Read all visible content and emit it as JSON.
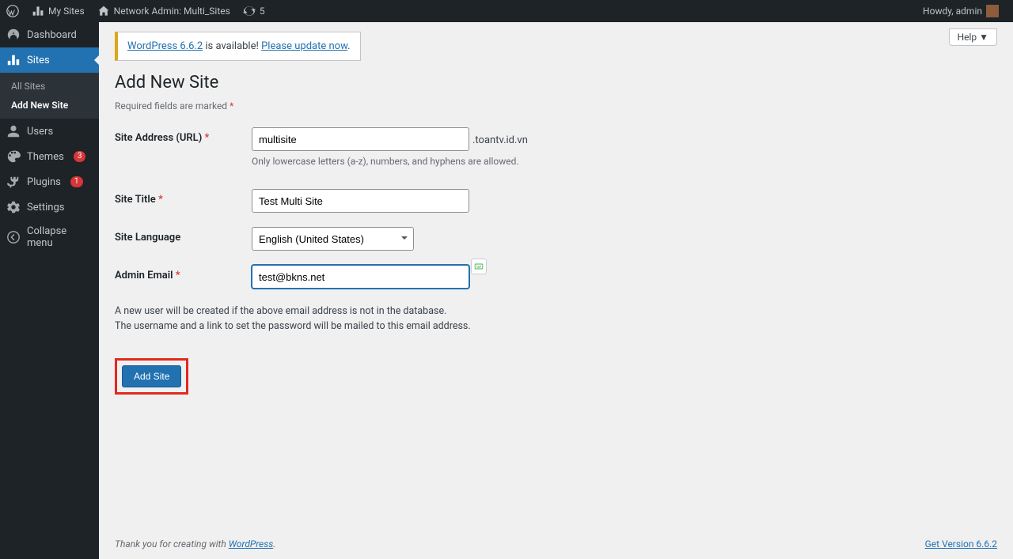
{
  "adminbar": {
    "my_sites": "My Sites",
    "network_admin": "Network Admin: Multi_Sites",
    "updates_count": "5",
    "howdy": "Howdy, admin"
  },
  "sidebar": {
    "dashboard": "Dashboard",
    "sites": "Sites",
    "all_sites": "All Sites",
    "add_new_site": "Add New Site",
    "users": "Users",
    "themes": "Themes",
    "themes_badge": "3",
    "plugins": "Plugins",
    "plugins_badge": "1",
    "settings": "Settings",
    "collapse": "Collapse menu"
  },
  "help_label": "Help ▼",
  "notice": {
    "link1": "WordPress 6.6.2",
    "mid": " is available! ",
    "link2": "Please update now"
  },
  "page": {
    "title": "Add New Site",
    "required_note": "Required fields are marked "
  },
  "form": {
    "site_address_label": "Site Address (URL) ",
    "site_address_value": "multisite",
    "site_address_suffix": ".toantv.id.vn",
    "site_address_hint": "Only lowercase letters (a-z), numbers, and hyphens are allowed.",
    "site_title_label": "Site Title ",
    "site_title_value": "Test Multi Site",
    "site_language_label": "Site Language",
    "site_language_value": "English (United States)",
    "admin_email_label": "Admin Email ",
    "admin_email_value": "test@bkns.net",
    "info_line1": "A new user will be created if the above email address is not in the database.",
    "info_line2": "The username and a link to set the password will be mailed to this email address.",
    "submit": "Add Site"
  },
  "footer": {
    "thank": "Thank you for creating with ",
    "wp": "WordPress",
    "version": "Get Version 6.6.2"
  }
}
